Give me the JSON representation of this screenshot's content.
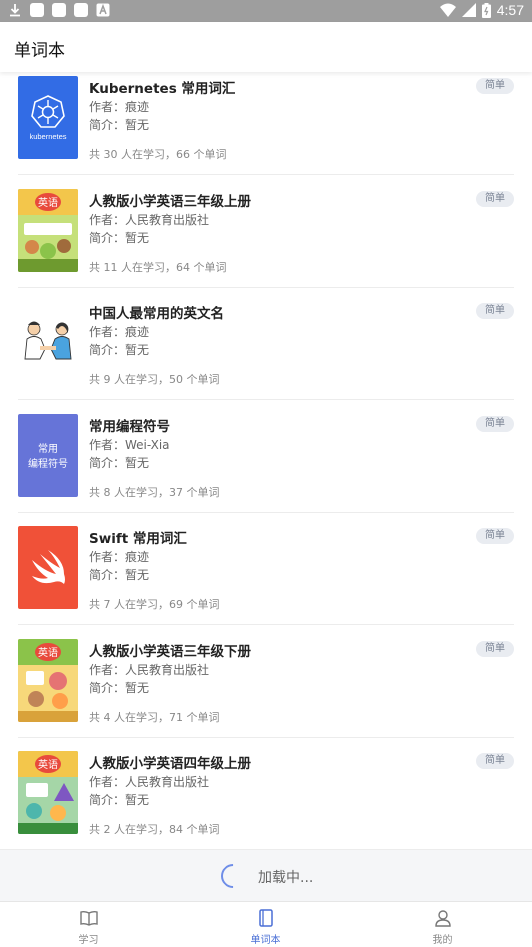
{
  "status_bar": {
    "time": "4:57"
  },
  "app_bar": {
    "title": "单词本"
  },
  "books": [
    {
      "title": "Kubernetes 常用词汇",
      "author": "作者：痕迹",
      "intro": "简介：暂无",
      "stats": "共 30 人在学习，66 个单词",
      "badge": "简单",
      "cover": "kubernetes",
      "cover_text": "kubernetes",
      "cover_color": "#326ce5"
    },
    {
      "title": "人教版小学英语三年级上册",
      "author": "作者：人民教育出版社",
      "intro": "简介：暂无",
      "stats": "共 11 人在学习，64 个单词",
      "badge": "简单",
      "cover": "textbook-3a",
      "cover_text": "英语",
      "cover_color": "#7cb342"
    },
    {
      "title": "中国人最常用的英文名",
      "author": "作者：痕迹",
      "intro": "简介：暂无",
      "stats": "共 9 人在学习，50 个单词",
      "badge": "简单",
      "cover": "handshake",
      "cover_color": "#ffffff"
    },
    {
      "title": "常用编程符号",
      "author": "作者：Wei-Xia",
      "intro": "简介：暂无",
      "stats": "共 8 人在学习，37 个单词",
      "badge": "简单",
      "cover": "coding",
      "cover_text_1": "常用",
      "cover_text_2": "编程符号",
      "cover_color": "#6674d8"
    },
    {
      "title": "Swift 常用词汇",
      "author": "作者：痕迹",
      "intro": "简介：暂无",
      "stats": "共 7 人在学习，69 个单词",
      "badge": "简单",
      "cover": "swift",
      "cover_color": "#f05138"
    },
    {
      "title": "人教版小学英语三年级下册",
      "author": "作者：人民教育出版社",
      "intro": "简介：暂无",
      "stats": "共 4 人在学习，71 个单词",
      "badge": "简单",
      "cover": "textbook-3b",
      "cover_text": "英语",
      "cover_color": "#f0b93a"
    },
    {
      "title": "人教版小学英语四年级上册",
      "author": "作者：人民教育出版社",
      "intro": "简介：暂无",
      "stats": "共 2 人在学习，84 个单词",
      "badge": "简单",
      "cover": "textbook-4a",
      "cover_text": "英语",
      "cover_color": "#4caf50"
    }
  ],
  "loading": {
    "text": "加载中..."
  },
  "tabs": [
    {
      "label": "学习",
      "icon": "book-open-icon",
      "active": false
    },
    {
      "label": "单词本",
      "icon": "notebook-icon",
      "active": true
    },
    {
      "label": "我的",
      "icon": "user-icon",
      "active": false
    }
  ],
  "colors": {
    "accent": "#4a6fd6",
    "badge_bg": "#e9ecf1",
    "badge_text": "#7a8394"
  }
}
